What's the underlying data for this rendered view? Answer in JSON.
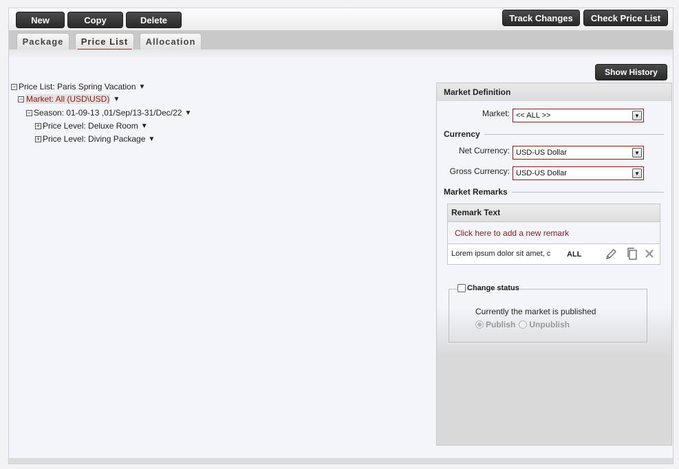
{
  "toolbar": {
    "new_label": "New",
    "copy_label": "Copy",
    "delete_label": "Delete",
    "track_changes_label": "Track Changes",
    "check_price_list_label": "Check Price List"
  },
  "tabs": [
    {
      "label": "Package"
    },
    {
      "label": "Price List",
      "active": true
    },
    {
      "label": "Allocation"
    }
  ],
  "tree": {
    "price_list": "Price List: Paris Spring Vacation",
    "market": "Market: All (USD\\USD)",
    "season": "Season: 01-09-13 ,01/Sep/13-31/Dec/22",
    "levels": [
      "Price Level: Deluxe Room",
      "Price Level: Diving Package"
    ],
    "caret": "▼",
    "collapse_symbol": "−",
    "expand_symbol": "+"
  },
  "show_history_label": "Show History",
  "market_definition": {
    "title": "Market Definition",
    "market_label": "Market:",
    "market_value": "<< ALL >>",
    "currency_title": "Currency",
    "net_currency_label": "Net Currency:",
    "net_currency_value": "USD-US Dollar",
    "gross_currency_label": "Gross Currency:",
    "gross_currency_value": "USD-US Dollar",
    "remarks_title": "Market Remarks",
    "remarks_table": {
      "header": "Remark Text",
      "add_link": "Click here to add a new remark",
      "rows": [
        {
          "text": "Lorem ipsum dolor sit amet, c",
          "market": "ALL"
        }
      ]
    },
    "change_status_label": "Change status",
    "status_text": "Currently the market is published",
    "publish_label": "Publish",
    "unpublish_label": "Unpublish",
    "selected_status": "Publish"
  },
  "colors": {
    "button_bg": "#2f2f2f",
    "accent_red": "#c8102e",
    "link_red": "#8b1b1b"
  },
  "icons": {
    "edit": "pencil-icon",
    "copy": "copy-icon",
    "delete": "close-icon",
    "dropdown": "chevron-down-icon"
  }
}
